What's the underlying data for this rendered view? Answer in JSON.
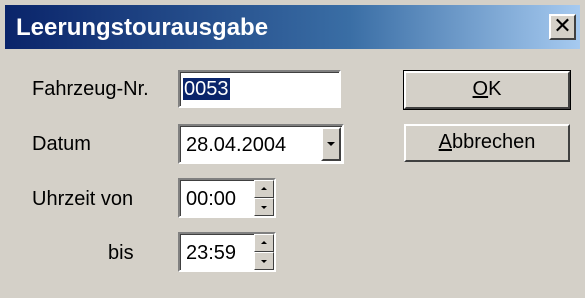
{
  "window": {
    "title": "Leerungstourausgabe",
    "close_glyph": "✕"
  },
  "form": {
    "vehicle_label": "Fahrzeug-Nr.",
    "vehicle_value": "0053",
    "date_label": "Datum",
    "date_value": "28.04.2004",
    "time_from_label": "Uhrzeit von",
    "time_from_value": "00:00",
    "time_to_label": "bis",
    "time_to_value": "23:59"
  },
  "buttons": {
    "ok_mnemonic": "O",
    "ok_rest": "K",
    "cancel_mnemonic": "A",
    "cancel_rest": "bbrechen"
  },
  "colors": {
    "dialog_bg": "#d4d0c8",
    "titlebar_start": "#0a246a",
    "titlebar_end": "#a6caf0",
    "selection": "#0a246a"
  }
}
